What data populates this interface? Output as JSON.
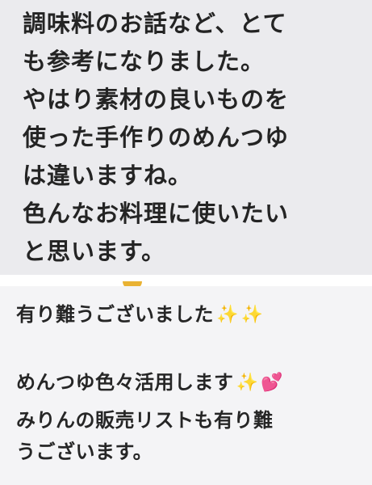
{
  "top_message": {
    "lines": [
      "調味料のお話など、とて",
      "も参考になりました。",
      "やはり素材の良いものを",
      "使った手作りのめんつゆ",
      "は違いますね。",
      "色んなお料理に使いたい",
      "と思います。"
    ]
  },
  "bottom_message": {
    "line1_text": "有り難うございました",
    "line1_emoji_1": "✨",
    "line1_emoji_2": "✨",
    "line2_text": "めんつゆ色々活用します",
    "line2_emoji_1": "✨",
    "line2_emoji_2": "💕",
    "line3_text": "みりんの販売リストも有り難",
    "line4_text": "うございます。"
  },
  "colors": {
    "top_bubble": "#ebebee",
    "bottom_bubble": "#f4f4f6",
    "sparkle": "#f2c21b",
    "heart": "#f05aa0"
  }
}
